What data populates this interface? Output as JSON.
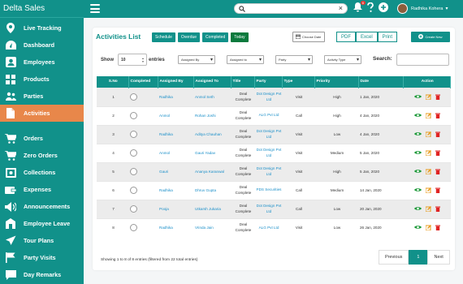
{
  "app": {
    "title": "Delta Sales"
  },
  "sidebar": {
    "items": [
      {
        "label": "Live Tracking",
        "icon": "location-pin-icon"
      },
      {
        "label": "Dashboard",
        "icon": "dashboard-icon"
      },
      {
        "label": "Employees",
        "icon": "employee-icon"
      },
      {
        "label": "Products",
        "icon": "products-grid-icon"
      },
      {
        "label": "Parties",
        "icon": "parties-icon"
      },
      {
        "label": "Activities",
        "icon": "document-icon",
        "active": true
      },
      {
        "label": "Orders",
        "icon": "cart-icon"
      },
      {
        "label": "Zero Orders",
        "icon": "cart-icon"
      },
      {
        "label": "Collections",
        "icon": "collections-icon"
      },
      {
        "label": "Expenses",
        "icon": "expenses-icon"
      },
      {
        "label": "Announcements",
        "icon": "megaphone-icon"
      },
      {
        "label": "Employee Leave",
        "icon": "leave-icon"
      },
      {
        "label": "Tour Plans",
        "icon": "plane-icon"
      },
      {
        "label": "Party Visits",
        "icon": "flag-icon"
      },
      {
        "label": "Day Remarks",
        "icon": "chat-icon"
      }
    ]
  },
  "topbar": {
    "search_value": "",
    "notification_count": "6",
    "user_name": "Radhika Kohera"
  },
  "page": {
    "title": "Activities List",
    "tabs": [
      "Schedule",
      "Overdue",
      "Completed",
      "Today"
    ],
    "choose_date": "Choose Date",
    "export": [
      "PDF",
      "Excel",
      "Print"
    ],
    "create_new": "Create New",
    "show_label": "Show",
    "show_value": "10",
    "entries_label": "entries",
    "filters": [
      "Assigned By",
      "Assigned to",
      "Party",
      "Activity Type"
    ],
    "search_label": "Search:",
    "search_value": ""
  },
  "table": {
    "headers": [
      "S.No",
      "Completed",
      "Assigned By",
      "Assigned To",
      "Title",
      "Party",
      "Type",
      "Priority",
      "Date",
      "Action"
    ],
    "rows": [
      {
        "sno": "1",
        "by": "Radhika",
        "to": "Anmol Seth",
        "title": "Deal Complete",
        "party": "Dot Design Pvt Ltd",
        "type": "Visit",
        "priority": "High",
        "date": "1 Jan, 2020"
      },
      {
        "sno": "2",
        "by": "Anmol",
        "to": "Rohan Joshi",
        "title": "Deal Complete",
        "party": "ALG Pvt Ltd",
        "type": "Call",
        "priority": "High",
        "date": "4 Jan, 2020"
      },
      {
        "sno": "3",
        "by": "Radhika",
        "to": "Aditya Chauhan",
        "title": "Deal Complete",
        "party": "Dot Design Pvt Ltd",
        "type": "Visit",
        "priority": "Low",
        "date": "4 Jan, 2020"
      },
      {
        "sno": "4",
        "by": "Anmol",
        "to": "Gauri Yadav",
        "title": "Deal Complete",
        "party": "Dot Design Pvt Ltd",
        "type": "Visit",
        "priority": "Medium",
        "date": "5 Jan, 2020"
      },
      {
        "sno": "5",
        "by": "Gauri",
        "to": "Ananya Karanwal",
        "title": "Deal Complete",
        "party": "Dot Design Pvt Ltd",
        "type": "Visit",
        "priority": "High",
        "date": "5 Jan, 2020"
      },
      {
        "sno": "6",
        "by": "Radhika",
        "to": "Dhruv Gupta",
        "title": "Deal Complete",
        "party": "PDS Securities",
        "type": "Call",
        "priority": "Medium",
        "date": "14 Jan, 2020"
      },
      {
        "sno": "7",
        "by": "Pooja",
        "to": "Utkarsh Jukaria",
        "title": "Deal Complete",
        "party": "Dot Design Pvt Ltd",
        "type": "Call",
        "priority": "Low",
        "date": "20 Jan, 2020"
      },
      {
        "sno": "8",
        "by": "Radhika",
        "to": "Vrinda Jain",
        "title": "Deal Complete",
        "party": "ALG Pvt Ltd",
        "type": "Visit",
        "priority": "Low",
        "date": "26 Jan, 2020"
      }
    ]
  },
  "footer": {
    "info": "Showing 1 to 8 of 8 entries (filtered from 22 total entries)",
    "prev": "Previous",
    "page": "1",
    "next": "Next"
  },
  "colors": {
    "primary": "#11918a",
    "active": "#e8874a",
    "link": "#1a8fc9"
  }
}
